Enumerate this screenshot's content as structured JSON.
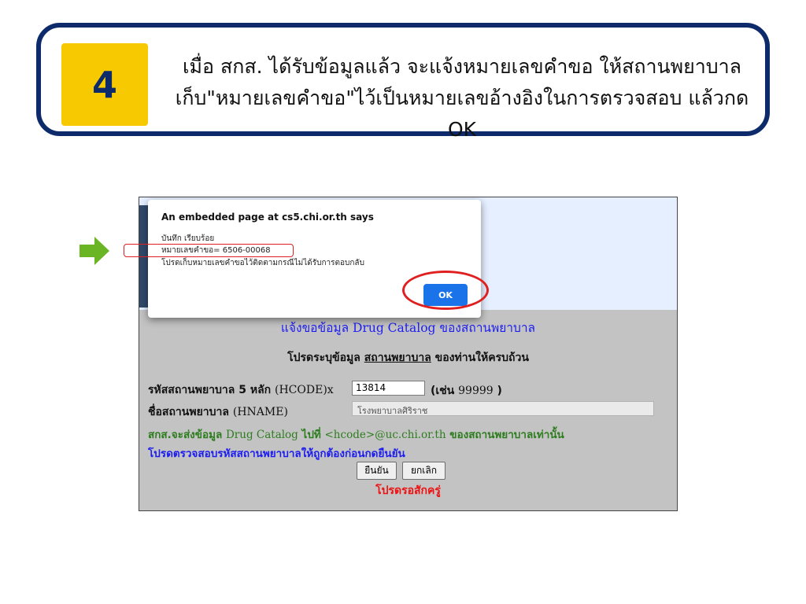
{
  "step": {
    "number": "4",
    "line1": "เมื่อ สกส. ได้รับข้อมูลแล้ว จะแจ้งหมายเลขคำขอ ให้สถานพยาบาล",
    "line2": "เก็บ\"หมายเลขคำขอ\"ไว้เป็นหมายเลขอ้างอิงในการตรวจสอบ แล้วกด OK"
  },
  "dialog": {
    "title": "An embedded page at cs5.chi.or.th says",
    "line1": "บันทึก เรียบร้อย",
    "line2": "หมายเลขคำขอ= 6506-00068",
    "line3": "โปรดเก็บหมายเลขคำขอไว้ติดตามกรณีไม่ได้รับการตอบกลับ",
    "ok_label": "OK"
  },
  "form": {
    "title": "แจ้งขอข้อมูล Drug Catalog ของสถานพยาบาล",
    "sub_before": "โปรดระบุข้อมูล ",
    "sub_link": "สถานพยาบาล",
    "sub_after": " ของท่านให้ครบถ้วน",
    "hcode_label_thai": "รหัสสถานพยาบาล 5 หลัก ",
    "hcode_label_code": "(HCODE)x",
    "hcode_value": "13814",
    "hcode_example_before": "(เช่น ",
    "hcode_example_code": "99999",
    "hcode_example_after": " )",
    "hname_label_thai": "ชื่อสถานพยาบาล ",
    "hname_label_code": "(HNAME)",
    "hname_value": "โรงพยาบาลศิริราช",
    "note_green_a": "สกส.จะส่งข้อมูล ",
    "note_green_b": "Drug Catalog",
    "note_green_c": " ไปที่ ",
    "note_green_d": "<hcode>@uc.chi.or.th",
    "note_green_e": " ของสถานพยาบาลเท่านั้น",
    "note_blue": "โปรดตรวจสอบรหัสสถานพยาบาลให้ถูกต้องก่อนกดยืนยัน",
    "confirm_label": "ยืนยัน",
    "cancel_label": "ยกเลิก",
    "wait_text": "โปรดรอสักครู่"
  },
  "colors": {
    "banner_border": "#0d2b6b",
    "badge": "#f7c900",
    "arrow": "#6ab523",
    "highlight": "#e02020",
    "ok_button": "#1a73e8"
  }
}
